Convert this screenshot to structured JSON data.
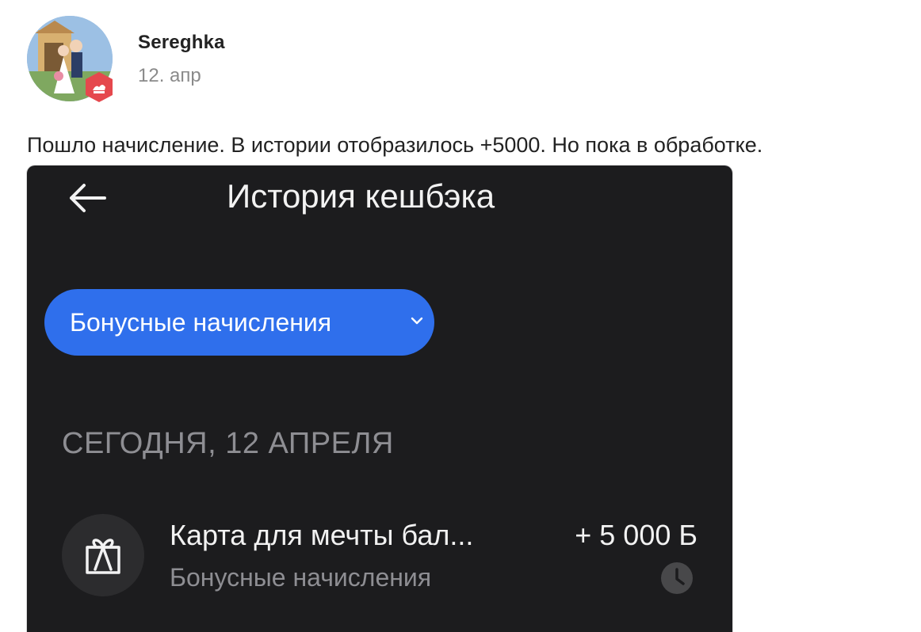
{
  "post": {
    "username": "Sereghka",
    "date": "12. апр",
    "text": "Пошло начисление. В истории отобразилось +5000. Но пока в обработке."
  },
  "screenshot": {
    "screen_title": "История кешбэка",
    "filter_chip_label": "Бонусные начисления",
    "section_header": "СЕГОДНЯ, 12 АПРЕЛЯ",
    "transaction": {
      "title": "Карта для мечты бал...",
      "subtitle": "Бонусные начисления",
      "amount": "+ 5 000 Б",
      "status_icon": "clock-icon",
      "icon": "gift-icon"
    },
    "colors": {
      "background": "#1c1c1e",
      "chip": "#2f6fec",
      "badge": "#e5484d"
    }
  }
}
